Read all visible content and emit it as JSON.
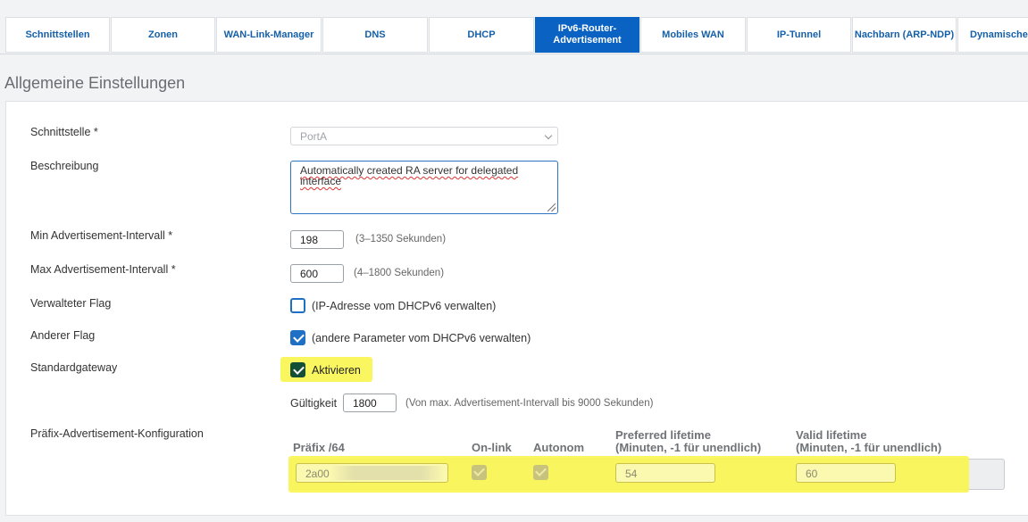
{
  "tabs": [
    {
      "label": "Schnittstellen"
    },
    {
      "label": "Zonen"
    },
    {
      "label": "WAN-Link-Manager"
    },
    {
      "label": "DNS"
    },
    {
      "label": "DHCP"
    },
    {
      "label": "IPv6-Router-\nAdvertisement",
      "line1": "IPv6-Router-",
      "line2": "Advertisement"
    },
    {
      "label": "Mobiles WAN"
    },
    {
      "label": "IP-Tunnel"
    },
    {
      "label": "Nachbarn (ARP-NDP)"
    },
    {
      "label": "Dynamischer"
    }
  ],
  "section_title": "Allgemeine Einstellungen",
  "fields": {
    "interface_label": "Schnittstelle *",
    "interface_value": "PortA",
    "description_label": "Beschreibung",
    "description_value": "Automatically created RA server for delegated interface",
    "min_label": "Min Advertisement-Intervall *",
    "min_value": "198",
    "min_hint": "(3–1350 Sekunden)",
    "max_label": "Max Advertisement-Intervall *",
    "max_value": "600",
    "max_hint": "(4–1800 Sekunden)",
    "managed_label": "Verwalteter Flag",
    "managed_text": "(IP-Adresse vom DHCPv6 verwalten)",
    "managed_checked": false,
    "other_label": "Anderer Flag",
    "other_text": "(andere Parameter vom DHCPv6 verwalten)",
    "other_checked": true,
    "gateway_label": "Standardgateway",
    "gateway_text": "Aktivieren",
    "gateway_checked": true,
    "validity_label": "Gültigkeit",
    "validity_value": "1800",
    "validity_hint": "(Von max. Advertisement-Intervall bis 9000 Sekunden)"
  },
  "prefix": {
    "label": "Präfix-Advertisement-Konfiguration",
    "col_prefix": "Präfix /64",
    "col_onlink": "On-link",
    "col_autonom": "Autonom",
    "col_preferred_1": "Preferred lifetime",
    "col_preferred_2": "(Minuten, -1 für unendlich)",
    "col_valid_1": "Valid lifetime",
    "col_valid_2": "(Minuten, -1 für unendlich)",
    "row": {
      "prefix_value": "2a00",
      "onlink": true,
      "autonom": true,
      "preferred": "54",
      "valid": "60"
    }
  },
  "colors": {
    "accent": "#0a62c2",
    "highlight": "#f8f553",
    "checkbox": "#1f6fc5"
  }
}
